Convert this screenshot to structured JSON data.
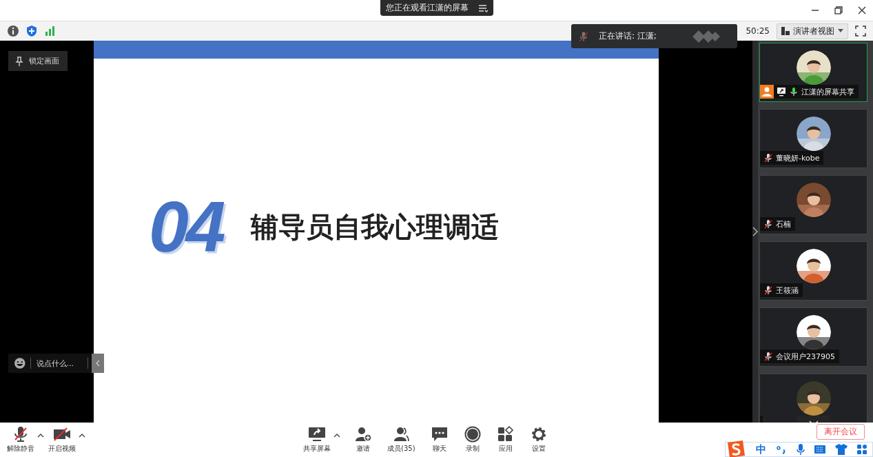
{
  "banner": {
    "text": "您正在观看江潇的屏幕"
  },
  "toolbar": {
    "timer": "50:25",
    "view_button": "演讲者视图"
  },
  "speaking": {
    "label": "正在讲话: 江潇;"
  },
  "lock_button": {
    "label": "锁定画面"
  },
  "chat": {
    "placeholder": "说点什么..."
  },
  "slide": {
    "number": "04",
    "title": "辅导员自我心理调适"
  },
  "participants": [
    {
      "name": "江潇的屏幕共享",
      "muted": false,
      "active": true,
      "host": true,
      "sharing": true
    },
    {
      "name": "董晓妍-kobe",
      "muted": true,
      "active": false,
      "host": false,
      "sharing": false
    },
    {
      "name": "石楠",
      "muted": true,
      "active": false,
      "host": false,
      "sharing": false
    },
    {
      "name": "王筱涵",
      "muted": true,
      "active": false,
      "host": false,
      "sharing": false
    },
    {
      "name": "会议用户237905",
      "muted": true,
      "active": false,
      "host": false,
      "sharing": false
    },
    {
      "active": false
    }
  ],
  "left_controls": [
    {
      "label": "解除静音",
      "kind": "mic",
      "menu": true
    },
    {
      "label": "开启视频",
      "kind": "video",
      "menu": true
    }
  ],
  "center_controls": [
    {
      "label": "共享屏幕",
      "kind": "share",
      "menu": true
    },
    {
      "label": "邀请",
      "kind": "invite",
      "menu": false
    },
    {
      "label": "成员(35)",
      "kind": "members",
      "menu": false
    },
    {
      "label": "聊天",
      "kind": "chat",
      "menu": false
    },
    {
      "label": "录制",
      "kind": "record",
      "menu": false
    },
    {
      "label": "应用",
      "kind": "apps",
      "menu": false
    },
    {
      "label": "设置",
      "kind": "settings",
      "menu": false
    }
  ],
  "leave_button": {
    "label": "离开会议"
  },
  "ime": {
    "mode": "中"
  }
}
